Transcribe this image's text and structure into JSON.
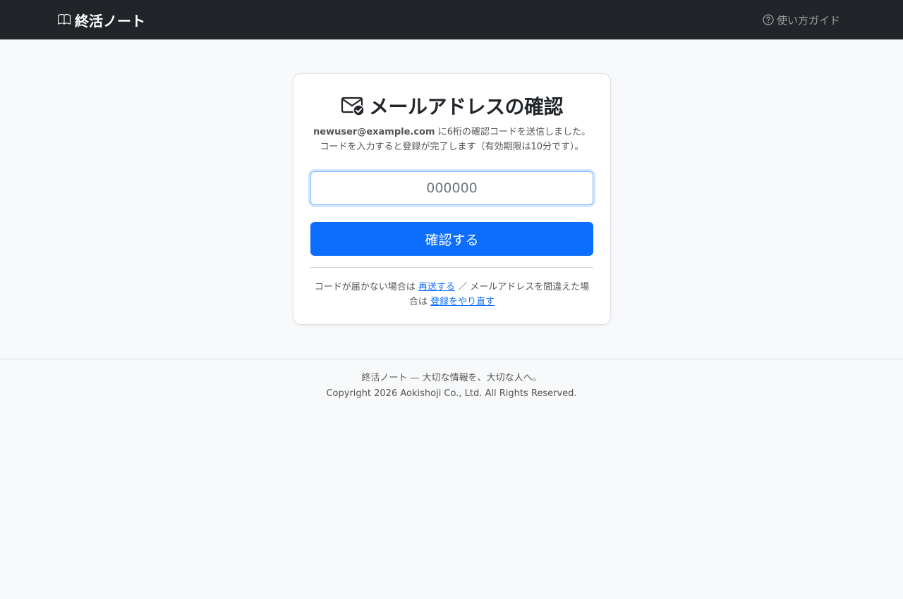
{
  "navbar": {
    "brand_icon": "book-icon",
    "brand": "終活ノート",
    "guide_icon": "question-circle-icon",
    "guide": "使い方ガイド"
  },
  "card": {
    "title_icon": "envelope-check-icon",
    "title": "メールアドレスの確認",
    "email": "newuser@example.com",
    "line1_rest": " に6桁の確認コードを送信しました。",
    "line2": "コードを入力すると登録が完了します（有効期限は10分です）。",
    "code_placeholder": "000000",
    "code_value": "",
    "confirm_button": "確認する",
    "help_prefix": "コードが届かない場合は ",
    "resend_link": "再送する",
    "help_middle": " ／ メールアドレスを間違えた場合は ",
    "redo_link": "登録をやり直す"
  },
  "footer": {
    "tagline": "終活ノート — 大切な情報を、大切な人へ。",
    "copyright": "Copyright 2026 Aokishoji Co., Ltd. All Rights Reserved."
  },
  "colors": {
    "navbar_bg": "#212529",
    "primary": "#0d6efd",
    "page_bg": "#f8f9fa"
  }
}
